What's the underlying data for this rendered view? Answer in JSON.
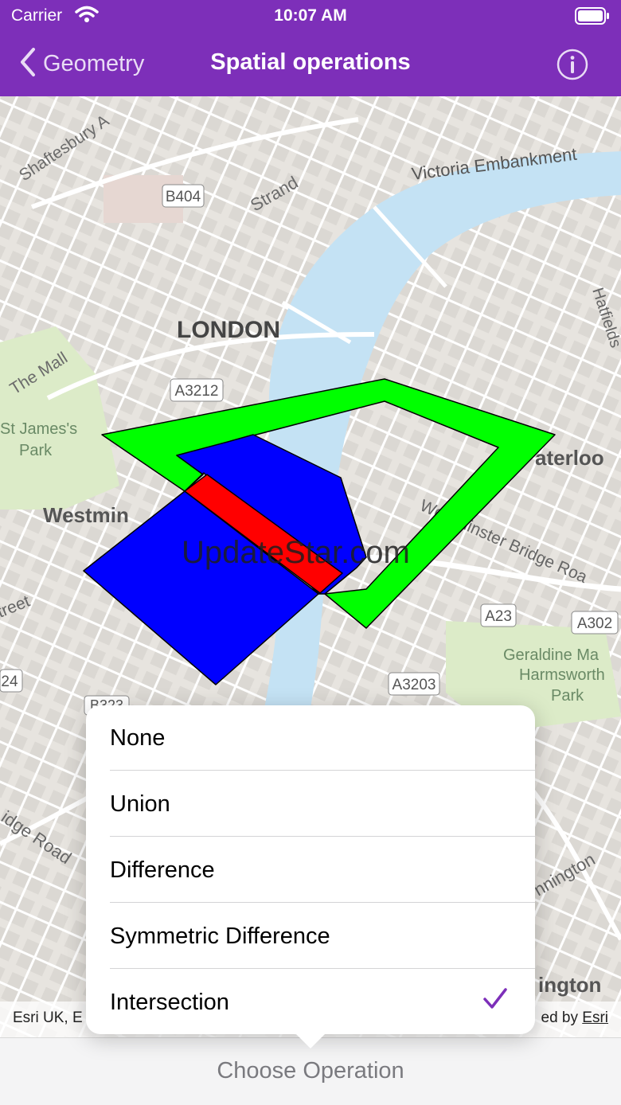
{
  "status_bar": {
    "carrier": "Carrier",
    "time": "10:07 AM"
  },
  "nav": {
    "back_label": "Geometry",
    "title": "Spatial operations"
  },
  "map": {
    "labels": [
      {
        "text": "Shaftesbury A",
        "cls": "road"
      },
      {
        "text": "B404",
        "cls": "shield"
      },
      {
        "text": "Strand",
        "cls": "road"
      },
      {
        "text": "Victoria Embankment",
        "cls": "road"
      },
      {
        "text": "LONDON",
        "cls": "city"
      },
      {
        "text": "The Mall",
        "cls": "road"
      },
      {
        "text": "A3212",
        "cls": "shield"
      },
      {
        "text": "St James's",
        "cls": "park"
      },
      {
        "text": "Park",
        "cls": "park"
      },
      {
        "text": "Westmin",
        "cls": "district"
      },
      {
        "text": "aterloo",
        "cls": "district"
      },
      {
        "text": "Hatfields",
        "cls": "road"
      },
      {
        "text": "Westminster Bridge Roa",
        "cls": "road"
      },
      {
        "text": "A23",
        "cls": "shield"
      },
      {
        "text": "A302",
        "cls": "shield"
      },
      {
        "text": "Geraldine Ma",
        "cls": "park"
      },
      {
        "text": "Harmsworth",
        "cls": "park"
      },
      {
        "text": "Park",
        "cls": "park"
      },
      {
        "text": "A3203",
        "cls": "shield"
      },
      {
        "text": "treet",
        "cls": "road"
      },
      {
        "text": "24",
        "cls": "shield"
      },
      {
        "text": "B323",
        "cls": "shield"
      },
      {
        "text": "idge Road",
        "cls": "road"
      },
      {
        "text": "nnington",
        "cls": "road"
      },
      {
        "text": "ington",
        "cls": "district"
      }
    ],
    "colors": {
      "union": "#00ff00",
      "intersection": "#ff0000",
      "polygon": "#0000ff",
      "water": "#c4e2f4",
      "park": "#dcebc8",
      "accent": "#7d2fb9"
    }
  },
  "watermark": "UpdateStar.com",
  "attribution": {
    "left": "Esri UK, E",
    "right_prefix": "ed by ",
    "right_link": "Esri"
  },
  "menu": {
    "options": [
      {
        "label": "None",
        "selected": false
      },
      {
        "label": "Union",
        "selected": false
      },
      {
        "label": "Difference",
        "selected": false
      },
      {
        "label": "Symmetric Difference",
        "selected": false
      },
      {
        "label": "Intersection",
        "selected": true
      }
    ]
  },
  "toolbar": {
    "choose_label": "Choose Operation"
  }
}
